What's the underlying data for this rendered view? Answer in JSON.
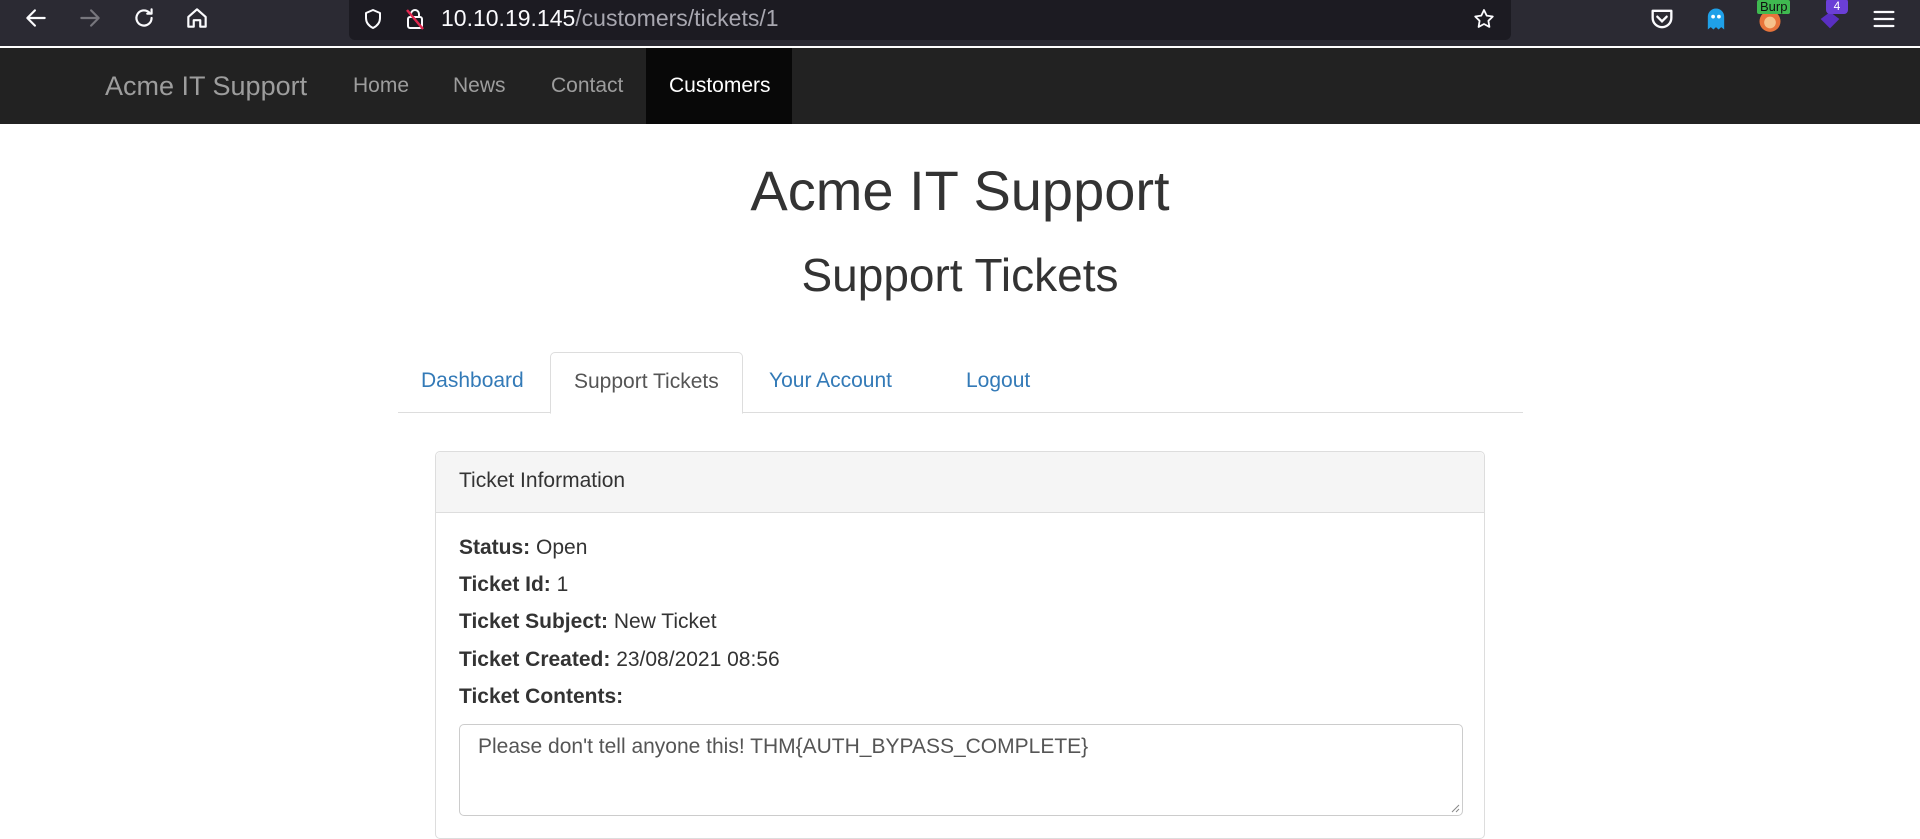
{
  "browser": {
    "url_host": "10.10.19.145",
    "url_path": "/customers/tickets/1",
    "extensions": {
      "burp_label": "Burp",
      "badge_count": "4"
    }
  },
  "navbar": {
    "brand": "Acme IT Support",
    "items": [
      {
        "label": "Home",
        "active": false
      },
      {
        "label": "News",
        "active": false
      },
      {
        "label": "Contact",
        "active": false
      },
      {
        "label": "Customers",
        "active": true
      }
    ]
  },
  "main": {
    "title": "Acme IT Support",
    "subtitle": "Support Tickets",
    "tabs": [
      {
        "label": "Dashboard",
        "active": false
      },
      {
        "label": "Support Tickets",
        "active": true
      },
      {
        "label": "Your Account",
        "active": false
      },
      {
        "label": "Logout",
        "active": false
      }
    ]
  },
  "ticket": {
    "panel_title": "Ticket Information",
    "status_label": "Status:",
    "status": "Open",
    "id_label": "Ticket Id:",
    "id": "1",
    "subject_label": "Ticket Subject:",
    "subject": "New Ticket",
    "created_label": "Ticket Created:",
    "created": "23/08/2021 08:56",
    "contents_label": "Ticket Contents:",
    "contents": "Please don't tell anyone this! THM{AUTH_BYPASS_COMPLETE}"
  },
  "colors": {
    "browser_bg": "#2b2a33",
    "navbar_bg": "#222222",
    "link": "#337ab7"
  }
}
